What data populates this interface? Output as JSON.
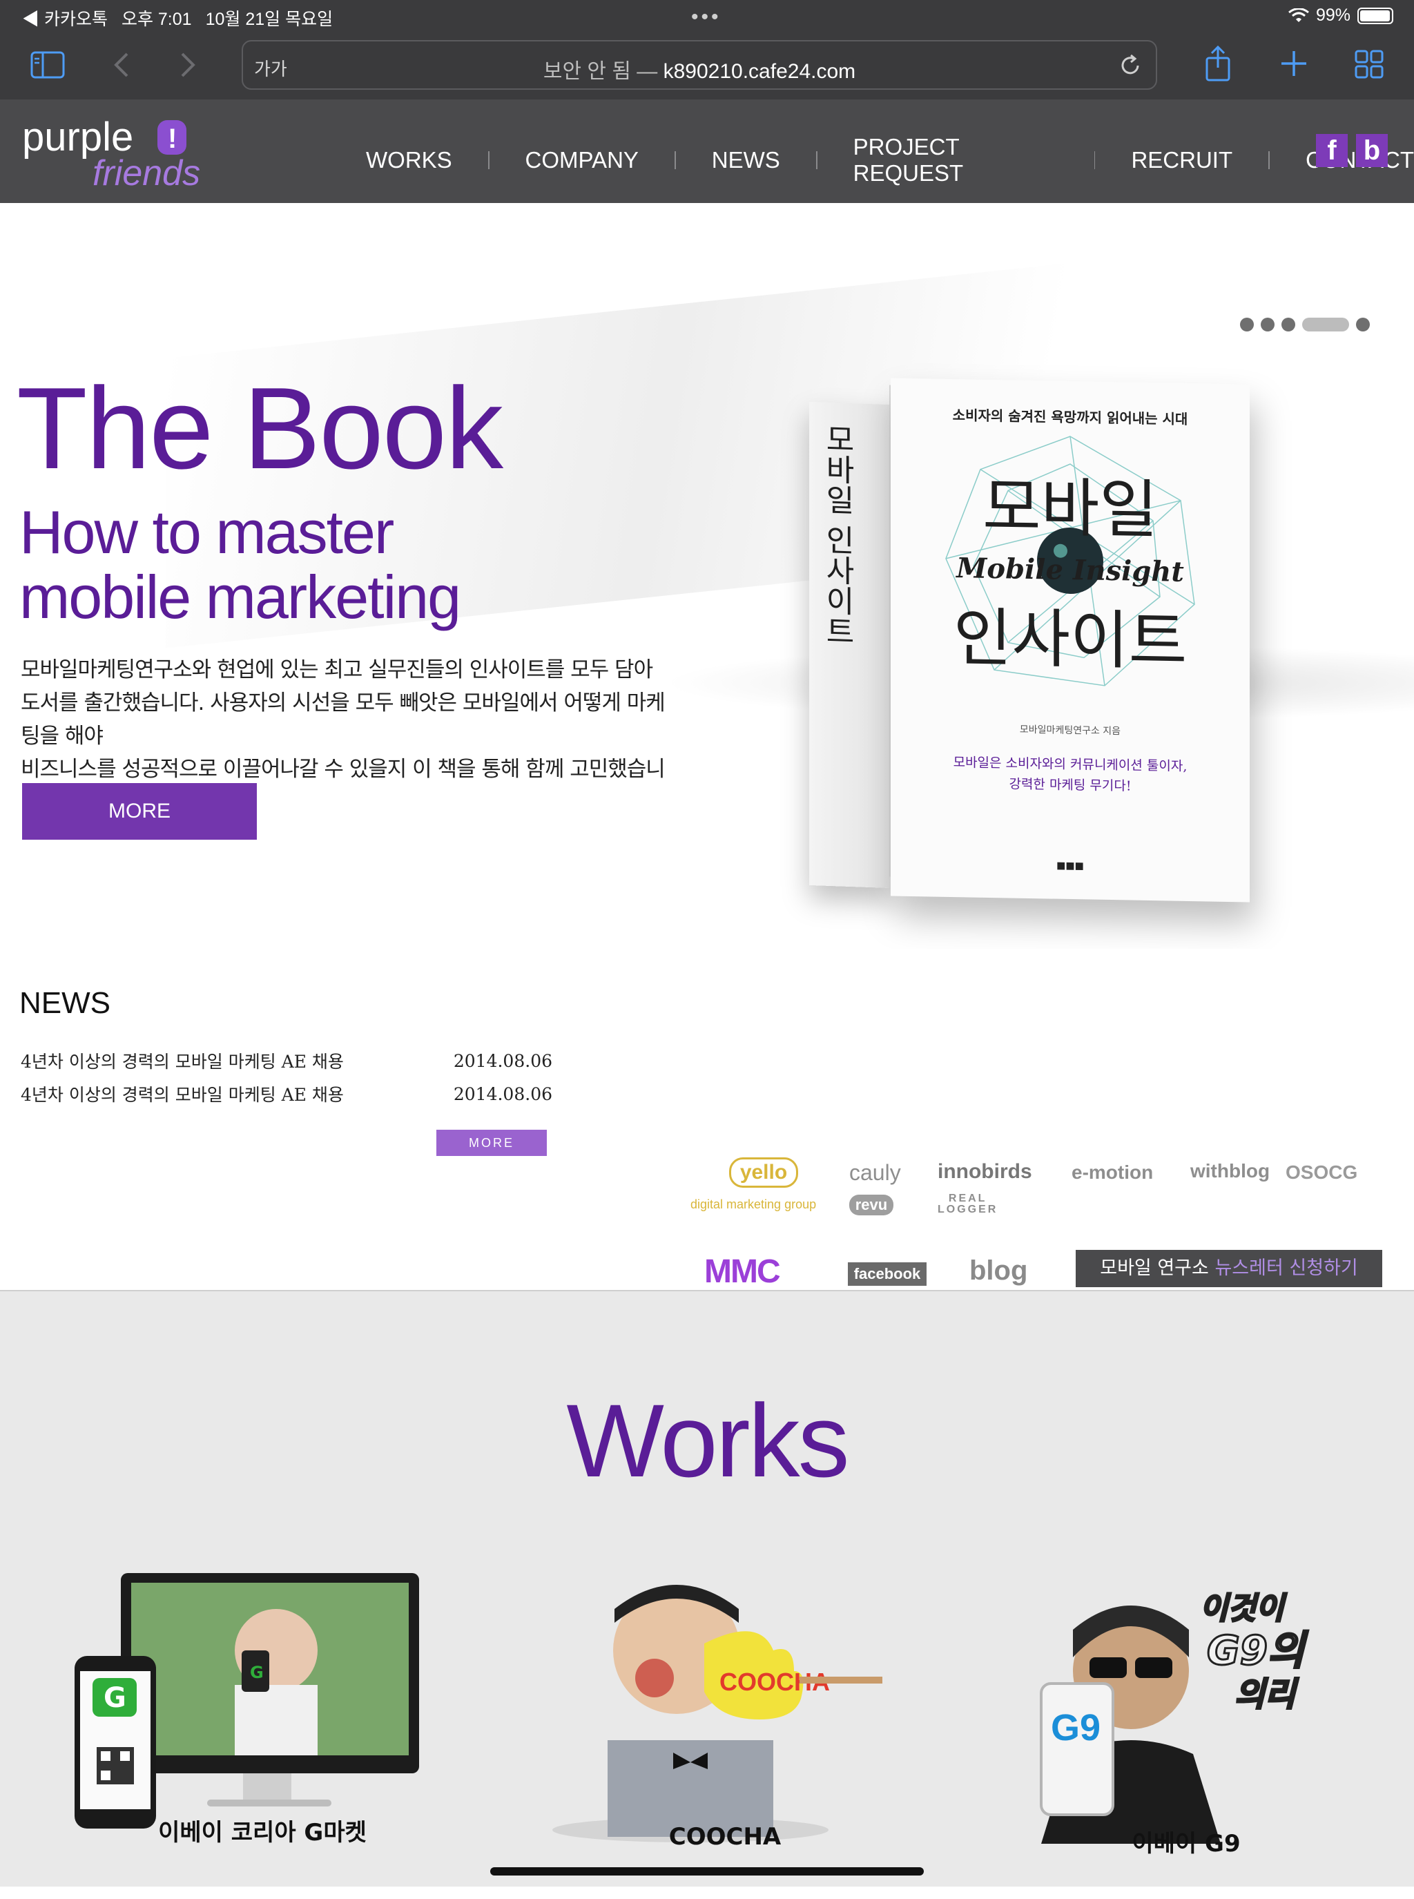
{
  "status_bar": {
    "back_app": "◀ 카카오톡",
    "time": "오후 7:01",
    "date": "10월 21일 목요일",
    "battery": "99%"
  },
  "browser": {
    "text_size_button": "가가",
    "insecure_label": "보안 안 됨",
    "separator": "—",
    "url": "k890210.cafe24.com"
  },
  "site": {
    "logo_top": "purple",
    "logo_bottom": "friends",
    "nav": [
      "WORKS",
      "COMPANY",
      "NEWS",
      "PROJECT REQUEST",
      "RECRUIT",
      "CONTACT"
    ],
    "social": [
      {
        "label": "f",
        "name": "facebook"
      },
      {
        "label": "b",
        "name": "blog"
      }
    ]
  },
  "hero": {
    "slider_total": 5,
    "slider_active_index": 3,
    "title": "The Book",
    "subtitle_line1": "How to master",
    "subtitle_line2": "mobile marketing",
    "description_line1": "모바일마케팅연구소와 현업에 있는 최고 실무진들의 인사이트를 모두 담아",
    "description_line2": "도서를 출간했습니다. 사용자의 시선을 모두 빼앗은 모바일에서 어떻게 마케팅을 해야",
    "description_line3": "비즈니스를 성공적으로 이끌어나갈 수 있을지 이 책을 통해 함께 고민했습니다.",
    "more_label": "MORE"
  },
  "book": {
    "tagline": "소비자의 숨겨진 욕망까지 읽어내는 시대",
    "title_line1": "모바일",
    "title_en": "Mobile Insight",
    "title_line2": "인사이트",
    "author": "모바일마케팅연구소 지음",
    "blurb_line1": "모바일은 소비자와의 커뮤니케이션 툴이자,",
    "blurb_line2": "강력한 마케팅 무기다!",
    "spine_title": "모바일 인사이트"
  },
  "news": {
    "title": "NEWS",
    "items": [
      {
        "title": "4년차 이상의 경력의 모바일 마케팅 AE 채용",
        "date": "2014.08.06"
      },
      {
        "title": "4년차 이상의 경력의 모바일 마케팅 AE 채용",
        "date": "2014.08.06"
      }
    ],
    "more_label": "MORE"
  },
  "partners": {
    "yello": "yello",
    "yello_sub": "digital marketing group",
    "cauly": "cauly",
    "innobirds": "innobirds",
    "emotion": "e-motion",
    "withblog": "withblog",
    "osocg": "OSOCG",
    "revu": "revu",
    "reallogger_1": "REAL",
    "reallogger_2": "LOGGER",
    "mmc": "MMC",
    "facebook": "facebook",
    "blog": "blog",
    "newsletter_prefix": "모바일 연구소",
    "newsletter_highlight": "뉴스레터 신청하기"
  },
  "works": {
    "title": "Works",
    "items": [
      {
        "label": "이베이 코리아 G마켓"
      },
      {
        "label": "COOCHA"
      },
      {
        "label": "이베이 G9"
      }
    ],
    "coocha_sign": "COOCHA",
    "g9_slogan_1": "이것이",
    "g9_slogan_2": "G9의",
    "g9_slogan_3": "의리",
    "g9_phone_logo": "G9",
    "gmarket_logo": "G"
  },
  "colors": {
    "brand_purple": "#5a1d97",
    "button_purple": "#7336ad",
    "header_gray": "#4a4a4c",
    "ios_blue": "#4e9cf5"
  }
}
